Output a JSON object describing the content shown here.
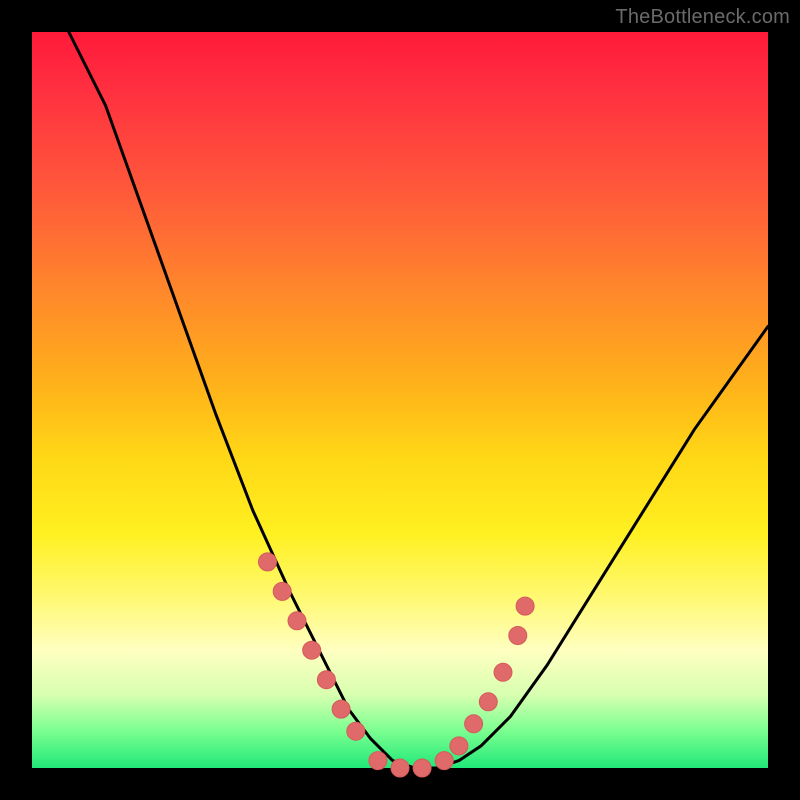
{
  "watermark": "TheBottleneck.com",
  "chart_data": {
    "type": "line",
    "title": "",
    "xlabel": "",
    "ylabel": "",
    "xlim": [
      0,
      100
    ],
    "ylim": [
      0,
      100
    ],
    "grid": false,
    "legend": false,
    "series": [
      {
        "name": "bottleneck-curve",
        "x": [
          5,
          10,
          15,
          20,
          25,
          30,
          35,
          40,
          43,
          46,
          49,
          52,
          55,
          58,
          61,
          65,
          70,
          75,
          80,
          85,
          90,
          95,
          100
        ],
        "y": [
          100,
          90,
          76,
          62,
          48,
          35,
          24,
          14,
          8,
          4,
          1,
          0,
          0,
          1,
          3,
          7,
          14,
          22,
          30,
          38,
          46,
          53,
          60
        ]
      }
    ],
    "markers": {
      "name": "highlight-dots",
      "x": [
        32,
        34,
        36,
        38,
        40,
        42,
        44,
        47,
        50,
        53,
        56,
        58,
        60,
        62,
        64,
        66,
        67
      ],
      "y": [
        28,
        24,
        20,
        16,
        12,
        8,
        5,
        1,
        0,
        0,
        1,
        3,
        6,
        9,
        13,
        18,
        22
      ]
    },
    "colors": {
      "curve": "#000000",
      "marker_fill": "#e06a6a",
      "marker_stroke": "#d65a5a"
    }
  }
}
